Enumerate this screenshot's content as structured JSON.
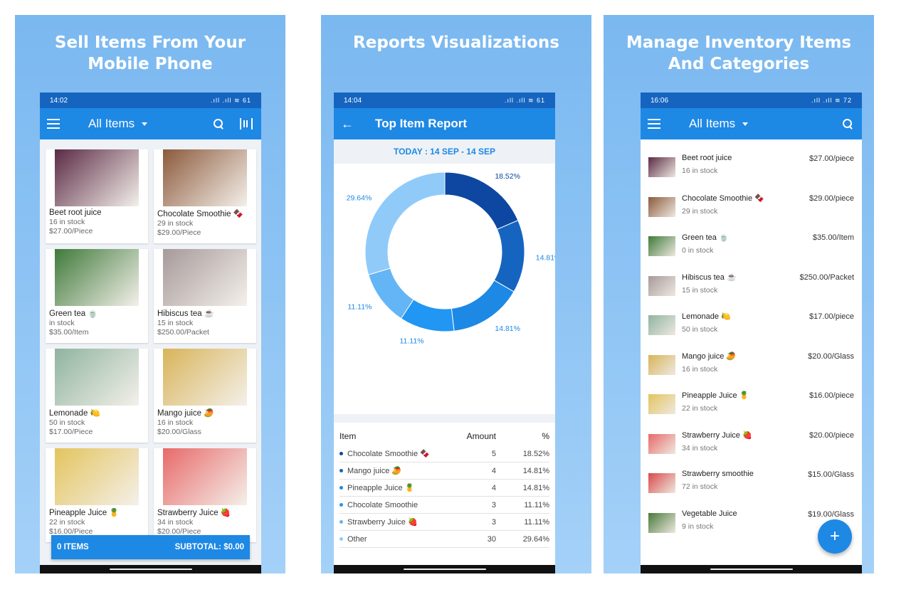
{
  "panels": [
    {
      "heading_line1": "Sell Items From Your",
      "heading_line2": "Mobile Phone",
      "status_time": "14:02",
      "status_icons": ".ıll .ıll ≋ 61",
      "appbar_title": "All Items",
      "items": [
        {
          "name": "Beet root juice",
          "stock": "16 in stock",
          "price": "$27.00/Piece",
          "color": "#5a2a45"
        },
        {
          "name": "Chocolate Smoothie 🍫",
          "stock": "29 in stock",
          "price": "$29.00/Piece",
          "color": "#8c5a3c"
        },
        {
          "name": "Green tea 🍵",
          "stock": " in stock",
          "price": "$35.00/Item",
          "color": "#3f7a3a"
        },
        {
          "name": "Hibiscus tea ☕",
          "stock": "15 in stock",
          "price": "$250.00/Packet",
          "color": "#a69a9a"
        },
        {
          "name": "Lemonade 🍋",
          "stock": "50 in stock",
          "price": "$17.00/Piece",
          "color": "#8fb4a0"
        },
        {
          "name": "Mango juice 🥭",
          "stock": "16 in stock",
          "price": "$20.00/Glass",
          "color": "#d8b45a"
        },
        {
          "name": "Pineapple Juice 🍍",
          "stock": "22 in stock",
          "price": "$16.00/Piece",
          "color": "#e3c45e"
        },
        {
          "name": "Strawberry Juice 🍓",
          "stock": "34 in stock",
          "price": "$20.00/Piece",
          "color": "#e86a6a"
        }
      ],
      "footer_items": "0 ITEMS",
      "footer_subtotal": "SUBTOTAL: $0.00"
    },
    {
      "heading_line1": "Reports Visualizations",
      "status_time": "14:04",
      "status_icons": ".ıll .ıll ≋ 61",
      "appbar_title": "Top Item Report",
      "date_range": "TODAY : 14 SEP  -  14 SEP",
      "table_headers": {
        "item": "Item",
        "amount": "Amount",
        "pct": "%"
      },
      "rows": [
        {
          "item": "Chocolate Smoothie 🍫",
          "amount": "5",
          "pct": "18.52%",
          "color": "#0d47a1"
        },
        {
          "item": "Mango juice 🥭",
          "amount": "4",
          "pct": "14.81%",
          "color": "#1565c0"
        },
        {
          "item": "Pineapple Juice 🍍",
          "amount": "4",
          "pct": "14.81%",
          "color": "#1e88e5"
        },
        {
          "item": "Chocolate Smoothie",
          "amount": "3",
          "pct": "11.11%",
          "color": "#2196f3"
        },
        {
          "item": "Strawberry Juice 🍓",
          "amount": "3",
          "pct": "11.11%",
          "color": "#64b5f6"
        },
        {
          "item": "Other",
          "amount": "30",
          "pct": "29.64%",
          "color": "#90caf9"
        }
      ]
    },
    {
      "heading_line1": "Manage Inventory Items",
      "heading_line2": "And Categories",
      "status_time": "16:06",
      "status_icons": ".ıll .ıll ≋ 72",
      "appbar_title": "All Items",
      "items": [
        {
          "name": "Beet root juice",
          "stock": "16 in stock",
          "price": "$27.00/piece",
          "color": "#5a2a45"
        },
        {
          "name": "Chocolate Smoothie 🍫",
          "stock": "29 in stock",
          "price": "$29.00/piece",
          "color": "#8c5a3c"
        },
        {
          "name": "Green tea 🍵",
          "stock": "0 in stock",
          "price": "$35.00/Item",
          "color": "#3f7a3a"
        },
        {
          "name": "Hibiscus tea ☕",
          "stock": "15 in stock",
          "price": "$250.00/Packet",
          "color": "#a69a9a"
        },
        {
          "name": "Lemonade 🍋",
          "stock": "50 in stock",
          "price": "$17.00/piece",
          "color": "#8fb4a0"
        },
        {
          "name": "Mango juice 🥭",
          "stock": "16 in stock",
          "price": "$20.00/Glass",
          "color": "#d8b45a"
        },
        {
          "name": "Pineapple Juice 🍍",
          "stock": "22 in stock",
          "price": "$16.00/piece",
          "color": "#e3c45e"
        },
        {
          "name": "Strawberry Juice 🍓",
          "stock": "34 in stock",
          "price": "$20.00/piece",
          "color": "#e86a6a"
        },
        {
          "name": "Strawberry smoothie",
          "stock": "72 in stock",
          "price": "$15.00/Glass",
          "color": "#d94a4a"
        },
        {
          "name": "Vegetable Juice",
          "stock": "9 in stock",
          "price": "$19.00/Glass",
          "color": "#4a7a3a"
        }
      ],
      "fab_label": "+"
    }
  ],
  "chart_data": {
    "type": "pie",
    "title": "",
    "categories": [
      "Chocolate Smoothie",
      "Mango juice",
      "Pineapple Juice",
      "Chocolate Smoothie",
      "Strawberry Juice",
      "Other"
    ],
    "values": [
      18.52,
      14.81,
      14.81,
      11.11,
      11.11,
      29.64
    ],
    "labels": [
      "18.52%",
      "14.81%",
      "14.81%",
      "11.11%",
      "11.11%",
      "29.64%"
    ],
    "colors": [
      "#0d47a1",
      "#1565c0",
      "#1e88e5",
      "#2196f3",
      "#64b5f6",
      "#90caf9"
    ],
    "donut": true
  }
}
